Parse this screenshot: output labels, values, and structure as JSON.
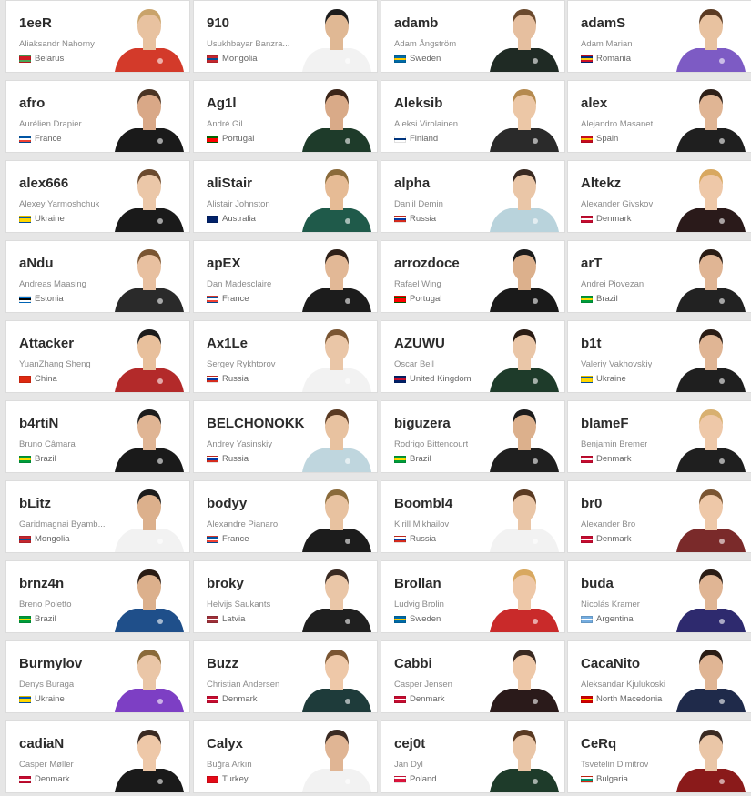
{
  "players": [
    {
      "nick": "1eeR",
      "name": "Aliaksandr Nahorny",
      "country": "Belarus",
      "flag": [
        "#cf1b24",
        "#cf1b24",
        "#4aa657"
      ],
      "jersey": "#d33a2a",
      "skin": "#e8c2a0",
      "hair": "#c9a36a"
    },
    {
      "nick": "910",
      "name": "Usukhbayar Banzra...",
      "country": "Mongolia",
      "flag": [
        "#c4272f",
        "#015197",
        "#c4272f"
      ],
      "jersey": "#f2f2f2",
      "skin": "#e0b894",
      "hair": "#1c1c1c"
    },
    {
      "nick": "adamb",
      "name": "Adam Ångström",
      "country": "Sweden",
      "flag": [
        "#006aa7",
        "#fecc00",
        "#006aa7"
      ],
      "jersey": "#1f2a24",
      "skin": "#e6bf9f",
      "hair": "#6b4a2e"
    },
    {
      "nick": "adamS",
      "name": "Adam Marian",
      "country": "Romania",
      "flag": [
        "#002b7f",
        "#fcd116",
        "#ce1126"
      ],
      "jersey": "#7d5bc4",
      "skin": "#e8c2a0",
      "hair": "#5a3a22"
    },
    {
      "nick": "afro",
      "name": "Aurélien Drapier",
      "country": "France",
      "flag": [
        "#0055a4",
        "#ffffff",
        "#ef4135"
      ],
      "jersey": "#1a1a1a",
      "skin": "#d9a887",
      "hair": "#4a3424"
    },
    {
      "nick": "Ag1l",
      "name": "André Gil",
      "country": "Portugal",
      "flag": [
        "#006600",
        "#ff0000",
        "#ff0000"
      ],
      "jersey": "#1e3b2a",
      "skin": "#d9aa88",
      "hair": "#3a2418"
    },
    {
      "nick": "Aleksib",
      "name": "Aleksi Virolainen",
      "country": "Finland",
      "flag": [
        "#ffffff",
        "#003580",
        "#ffffff"
      ],
      "jersey": "#2a2a2a",
      "skin": "#ecc7a6",
      "hair": "#b58a4f"
    },
    {
      "nick": "alex",
      "name": "Alejandro Masanet",
      "country": "Spain",
      "flag": [
        "#c60b1e",
        "#ffc400",
        "#c60b1e"
      ],
      "jersey": "#1f1f1f",
      "skin": "#e0b594",
      "hair": "#2e2018"
    },
    {
      "nick": "alex666",
      "name": "Alexey Yarmoshchuk",
      "country": "Ukraine",
      "flag": [
        "#0057b7",
        "#ffd700",
        "#ffd700"
      ],
      "jersey": "#1a1a1a",
      "skin": "#ebc7a8",
      "hair": "#6b4a2e"
    },
    {
      "nick": "aliStair",
      "name": "Alistair Johnston",
      "country": "Australia",
      "flag": [
        "#012169",
        "#012169",
        "#012169"
      ],
      "jersey": "#1f5a4a",
      "skin": "#e6bb95",
      "hair": "#8a6a3a"
    },
    {
      "nick": "alpha",
      "name": "Daniil Demin",
      "country": "Russia",
      "flag": [
        "#ffffff",
        "#0039a6",
        "#d52b1e"
      ],
      "jersey": "#b9d3dc",
      "skin": "#eac6a7",
      "hair": "#3a2a22"
    },
    {
      "nick": "Altekz",
      "name": "Alexander Givskov",
      "country": "Denmark",
      "flag": [
        "#c60c30",
        "#ffffff",
        "#c60c30"
      ],
      "jersey": "#2a1a1a",
      "skin": "#eec8a8",
      "hair": "#d8a860"
    },
    {
      "nick": "aNdu",
      "name": "Andreas Maasing",
      "country": "Estonia",
      "flag": [
        "#0072ce",
        "#000000",
        "#ffffff"
      ],
      "jersey": "#2a2a2a",
      "skin": "#e8c0a0",
      "hair": "#7a5532"
    },
    {
      "nick": "apEX",
      "name": "Dan Madesclaire",
      "country": "France",
      "flag": [
        "#0055a4",
        "#ffffff",
        "#ef4135"
      ],
      "jersey": "#1c1c1c",
      "skin": "#e2b896",
      "hair": "#2e2018"
    },
    {
      "nick": "arrozdoce",
      "name": "Rafael Wing",
      "country": "Portugal",
      "flag": [
        "#006600",
        "#ff0000",
        "#ff0000"
      ],
      "jersey": "#1a1a1a",
      "skin": "#dcb08c",
      "hair": "#1c1c1c"
    },
    {
      "nick": "arT",
      "name": "Andrei Piovezan",
      "country": "Brazil",
      "flag": [
        "#009c3b",
        "#ffdf00",
        "#009c3b"
      ],
      "jersey": "#222222",
      "skin": "#e0b594",
      "hair": "#2a1c14"
    },
    {
      "nick": "Attacker",
      "name": "YuanZhang Sheng",
      "country": "China",
      "flag": [
        "#de2910",
        "#de2910",
        "#de2910"
      ],
      "jersey": "#b32a2a",
      "skin": "#e8c09c",
      "hair": "#1c1c1c"
    },
    {
      "nick": "Ax1Le",
      "name": "Sergey Rykhtorov",
      "country": "Russia",
      "flag": [
        "#ffffff",
        "#0039a6",
        "#d52b1e"
      ],
      "jersey": "#f2f2f2",
      "skin": "#eac6a7",
      "hair": "#7a5532"
    },
    {
      "nick": "AZUWU",
      "name": "Oscar Bell",
      "country": "United Kingdom",
      "flag": [
        "#012169",
        "#c8102e",
        "#012169"
      ],
      "jersey": "#1e3b2a",
      "skin": "#eac6a7",
      "hair": "#2a1c14"
    },
    {
      "nick": "b1t",
      "name": "Valeriy Vakhovskiy",
      "country": "Ukraine",
      "flag": [
        "#0057b7",
        "#ffd700",
        "#ffd700"
      ],
      "jersey": "#1f1f1f",
      "skin": "#e0b594",
      "hair": "#2a1c14"
    },
    {
      "nick": "b4rtiN",
      "name": "Bruno Câmara",
      "country": "Brazil",
      "flag": [
        "#009c3b",
        "#ffdf00",
        "#009c3b"
      ],
      "jersey": "#1a1a1a",
      "skin": "#e0b594",
      "hair": "#1c1c1c"
    },
    {
      "nick": "BELCHONOKK",
      "name": "Andrey Yasinskiy",
      "country": "Russia",
      "flag": [
        "#ffffff",
        "#0039a6",
        "#d52b1e"
      ],
      "jersey": "#bfd6de",
      "skin": "#e8c2a0",
      "hair": "#5a3a22"
    },
    {
      "nick": "biguzera",
      "name": "Rodrigo Bittencourt",
      "country": "Brazil",
      "flag": [
        "#009c3b",
        "#ffdf00",
        "#009c3b"
      ],
      "jersey": "#1f1f1f",
      "skin": "#dcb08c",
      "hair": "#1c1c1c"
    },
    {
      "nick": "blameF",
      "name": "Benjamin Bremer",
      "country": "Denmark",
      "flag": [
        "#c60c30",
        "#ffffff",
        "#c60c30"
      ],
      "jersey": "#1f1f1f",
      "skin": "#eec8a8",
      "hair": "#d8b070"
    },
    {
      "nick": "bLitz",
      "name": "Garidmagnai Byamb...",
      "country": "Mongolia",
      "flag": [
        "#c4272f",
        "#015197",
        "#c4272f"
      ],
      "jersey": "#f2f2f2",
      "skin": "#dcb08c",
      "hair": "#1c1c1c"
    },
    {
      "nick": "bodyy",
      "name": "Alexandre Pianaro",
      "country": "France",
      "flag": [
        "#0055a4",
        "#ffffff",
        "#ef4135"
      ],
      "jersey": "#1c1c1c",
      "skin": "#e8c2a0",
      "hair": "#8a6a3a"
    },
    {
      "nick": "Boombl4",
      "name": "Kirill Mikhailov",
      "country": "Russia",
      "flag": [
        "#ffffff",
        "#0039a6",
        "#d52b1e"
      ],
      "jersey": "#f2f2f2",
      "skin": "#eac6a7",
      "hair": "#5a3a22"
    },
    {
      "nick": "br0",
      "name": "Alexander Bro",
      "country": "Denmark",
      "flag": [
        "#c60c30",
        "#ffffff",
        "#c60c30"
      ],
      "jersey": "#7a2a2a",
      "skin": "#eec8a8",
      "hair": "#7a5532"
    },
    {
      "nick": "brnz4n",
      "name": "Breno Poletto",
      "country": "Brazil",
      "flag": [
        "#009c3b",
        "#ffdf00",
        "#009c3b"
      ],
      "jersey": "#1f4f8a",
      "skin": "#dcb08c",
      "hair": "#2a1c14"
    },
    {
      "nick": "broky",
      "name": "Helvijs Saukants",
      "country": "Latvia",
      "flag": [
        "#9e3039",
        "#ffffff",
        "#9e3039"
      ],
      "jersey": "#1f1f1f",
      "skin": "#eac6a7",
      "hair": "#3a2a22"
    },
    {
      "nick": "Brollan",
      "name": "Ludvig Brolin",
      "country": "Sweden",
      "flag": [
        "#006aa7",
        "#fecc00",
        "#006aa7"
      ],
      "jersey": "#c92a2a",
      "skin": "#eec8a8",
      "hair": "#d8a860"
    },
    {
      "nick": "buda",
      "name": "Nicolás Kramer",
      "country": "Argentina",
      "flag": [
        "#74acdf",
        "#ffffff",
        "#74acdf"
      ],
      "jersey": "#2e2a6e",
      "skin": "#e0b594",
      "hair": "#2a1c14"
    },
    {
      "nick": "Burmylov",
      "name": "Denys Buraga",
      "country": "Ukraine",
      "flag": [
        "#0057b7",
        "#ffd700",
        "#ffd700"
      ],
      "jersey": "#7d3fc4",
      "skin": "#eac6a7",
      "hair": "#8a6a3a"
    },
    {
      "nick": "Buzz",
      "name": "Christian Andersen",
      "country": "Denmark",
      "flag": [
        "#c60c30",
        "#ffffff",
        "#c60c30"
      ],
      "jersey": "#1e3b3a",
      "skin": "#eec8a8",
      "hair": "#7a5532"
    },
    {
      "nick": "Cabbi",
      "name": "Casper Jensen",
      "country": "Denmark",
      "flag": [
        "#c60c30",
        "#ffffff",
        "#c60c30"
      ],
      "jersey": "#2a1a1a",
      "skin": "#eec8a8",
      "hair": "#3a2a22"
    },
    {
      "nick": "CacaNito",
      "name": "Aleksandar Kjulukoski",
      "country": "North Macedonia",
      "flag": [
        "#d20000",
        "#ffe600",
        "#d20000"
      ],
      "jersey": "#1f2a4a",
      "skin": "#e0b594",
      "hair": "#2a1c14"
    },
    {
      "nick": "cadiaN",
      "name": "Casper Møller",
      "country": "Denmark",
      "flag": [
        "#c60c30",
        "#ffffff",
        "#c60c30"
      ],
      "jersey": "#1a1a1a",
      "skin": "#eec8a8",
      "hair": "#3a2a22"
    },
    {
      "nick": "Calyx",
      "name": "Buğra Arkın",
      "country": "Turkey",
      "flag": [
        "#e30a17",
        "#e30a17",
        "#e30a17"
      ],
      "jersey": "#f2f2f2",
      "skin": "#e0b594",
      "hair": "#3a2a22"
    },
    {
      "nick": "cej0t",
      "name": "Jan Dyl",
      "country": "Poland",
      "flag": [
        "#ffffff",
        "#dc143c",
        "#dc143c"
      ],
      "jersey": "#1e3b2a",
      "skin": "#eac6a7",
      "hair": "#5a3a22"
    },
    {
      "nick": "CeRq",
      "name": "Tsvetelin Dimitrov",
      "country": "Bulgaria",
      "flag": [
        "#ffffff",
        "#00966e",
        "#d62612"
      ],
      "jersey": "#8a1a1a",
      "skin": "#eac6a7",
      "hair": "#3a2a22"
    }
  ]
}
